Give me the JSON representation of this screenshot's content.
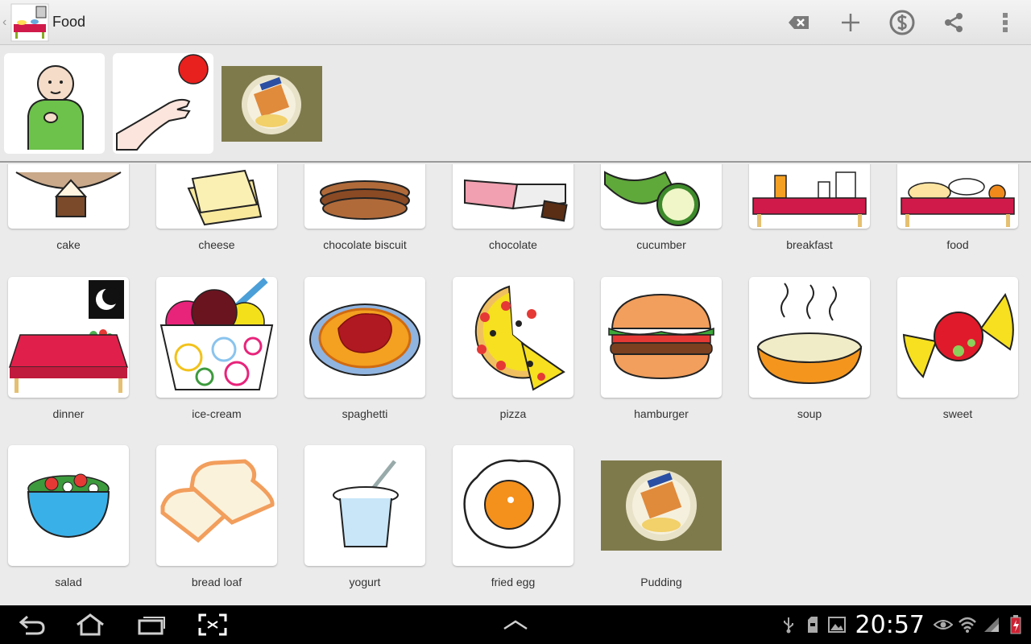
{
  "app": {
    "title": "Food"
  },
  "actions": [
    "backspace-icon",
    "add-icon",
    "currency-icon",
    "share-icon",
    "overflow-icon"
  ],
  "sentence_strip": [
    {
      "name": "i-symbol",
      "type": "pictogram"
    },
    {
      "name": "want-symbol",
      "type": "pictogram"
    },
    {
      "name": "pudding-photo",
      "type": "photo"
    }
  ],
  "grid": {
    "items": [
      {
        "label": "cake"
      },
      {
        "label": "cheese"
      },
      {
        "label": "chocolate biscuit"
      },
      {
        "label": "chocolate"
      },
      {
        "label": "cucumber"
      },
      {
        "label": "breakfast"
      },
      {
        "label": "food"
      },
      {
        "label": "dinner"
      },
      {
        "label": "ice-cream"
      },
      {
        "label": "spaghetti"
      },
      {
        "label": "pizza"
      },
      {
        "label": "hamburger"
      },
      {
        "label": "soup"
      },
      {
        "label": "sweet"
      },
      {
        "label": "salad"
      },
      {
        "label": "bread loaf"
      },
      {
        "label": "yogurt"
      },
      {
        "label": "fried egg"
      },
      {
        "label": "Pudding"
      }
    ]
  },
  "system_bar": {
    "time": "20:57"
  }
}
